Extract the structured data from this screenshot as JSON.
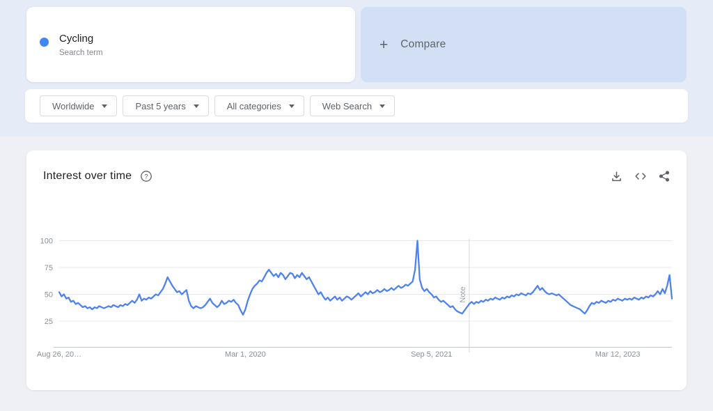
{
  "term_card": {
    "term": "Cycling",
    "subtitle": "Search term",
    "dot_color": "#4285f4"
  },
  "compare_card": {
    "plus_glyph": "+",
    "label": "Compare"
  },
  "filters": [
    {
      "label": "Worldwide"
    },
    {
      "label": "Past 5 years"
    },
    {
      "label": "All categories"
    },
    {
      "label": "Web Search"
    }
  ],
  "chart_card": {
    "title": "Interest over time",
    "action_icons": [
      "download-icon",
      "embed-icon",
      "share-icon"
    ],
    "help_glyph": "?"
  },
  "chart_data": {
    "type": "line",
    "title": "Interest over time",
    "series_name": "Cycling",
    "line_color": "#4e82ec",
    "grid": true,
    "ylim": [
      0,
      100
    ],
    "y_ticks": [
      25,
      50,
      75,
      100
    ],
    "x_range_weeks": 260,
    "x_ticks": [
      {
        "label": "Aug 26, 20…",
        "week": 0
      },
      {
        "label": "Mar 1, 2020",
        "week": 79
      },
      {
        "label": "Sep 5, 2021",
        "week": 158
      },
      {
        "label": "Mar 12, 2023",
        "week": 237
      }
    ],
    "note_marker": {
      "label": "Note",
      "week": 174
    },
    "values": [
      52,
      48,
      50,
      46,
      47,
      43,
      44,
      41,
      42,
      40,
      38,
      39,
      37,
      38,
      36,
      38,
      37,
      39,
      38,
      37,
      38,
      39,
      38,
      40,
      39,
      38,
      40,
      39,
      41,
      40,
      42,
      44,
      42,
      45,
      50,
      44,
      46,
      45,
      47,
      46,
      48,
      50,
      49,
      52,
      55,
      60,
      66,
      62,
      58,
      55,
      52,
      53,
      50,
      52,
      54,
      44,
      39,
      37,
      39,
      38,
      37,
      38,
      40,
      43,
      46,
      42,
      40,
      38,
      40,
      44,
      41,
      42,
      44,
      43,
      45,
      42,
      40,
      35,
      31,
      36,
      44,
      50,
      55,
      58,
      60,
      63,
      62,
      66,
      70,
      73,
      70,
      67,
      69,
      66,
      70,
      68,
      64,
      67,
      70,
      69,
      65,
      68,
      66,
      70,
      67,
      64,
      66,
      62,
      58,
      54,
      50,
      52,
      48,
      45,
      47,
      44,
      46,
      48,
      45,
      47,
      44,
      46,
      48,
      47,
      45,
      47,
      49,
      51,
      48,
      50,
      52,
      50,
      53,
      51,
      52,
      54,
      52,
      53,
      55,
      53,
      54,
      56,
      54,
      56,
      58,
      56,
      57,
      59,
      58,
      60,
      62,
      73,
      100,
      64,
      56,
      53,
      55,
      52,
      50,
      47,
      48,
      45,
      43,
      44,
      42,
      40,
      38,
      39,
      36,
      34,
      33,
      32,
      35,
      38,
      41,
      43,
      41,
      43,
      42,
      44,
      43,
      45,
      44,
      46,
      45,
      47,
      46,
      45,
      47,
      46,
      48,
      47,
      49,
      48,
      50,
      49,
      51,
      50,
      49,
      51,
      50,
      52,
      55,
      58,
      54,
      56,
      53,
      51,
      50,
      51,
      50,
      49,
      50,
      48,
      46,
      44,
      42,
      40,
      39,
      38,
      37,
      36,
      34,
      32,
      35,
      39,
      42,
      41,
      43,
      42,
      44,
      43,
      42,
      44,
      43,
      45,
      44,
      46,
      45,
      44,
      46,
      45,
      46,
      45,
      47,
      46,
      45,
      47,
      46,
      48,
      47,
      49,
      48,
      50,
      53,
      50,
      55,
      51,
      58,
      68,
      46
    ]
  }
}
